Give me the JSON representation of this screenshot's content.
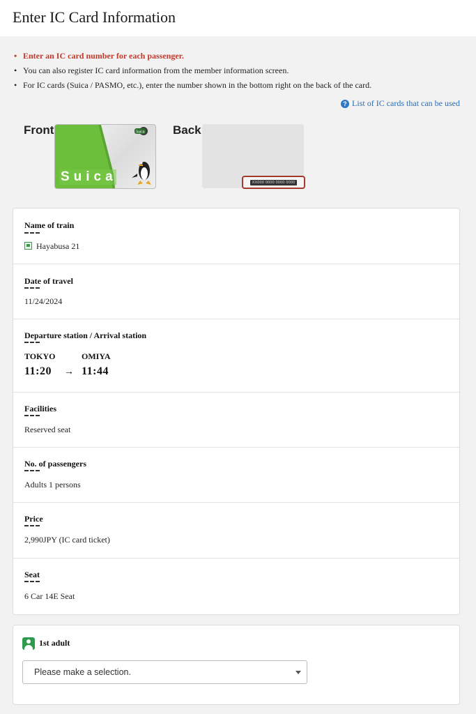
{
  "page": {
    "title": "Enter IC Card Information"
  },
  "notes": [
    "Enter an IC card number for each passenger.",
    "You can also register IC card information from the member information screen.",
    "For IC cards (Suica / PASMO, etc.), enter the number shown in the bottom right on the back of the card."
  ],
  "ic_link": {
    "label": "List of IC cards that can be used",
    "icon": "help-icon"
  },
  "card": {
    "front_label": "Front",
    "back_label": "Back",
    "brand": "Suica",
    "number_placeholder": "XX000 0000 0000 0000"
  },
  "trip": {
    "train": {
      "label": "Name of train",
      "value": "Hayabusa 21",
      "icon": "train-icon"
    },
    "date": {
      "label": "Date of travel",
      "value": "11/24/2024"
    },
    "stations": {
      "label": "Departure station / Arrival station",
      "departure": "TOKYO",
      "arrival": "OMIYA",
      "departure_time": "11:20",
      "arrow": "→",
      "arrival_time": "11:44"
    },
    "facilities": {
      "label": "Facilities",
      "value": "Reserved seat"
    },
    "passengers": {
      "label": "No. of passengers",
      "value": "Adults 1 persons"
    },
    "price": {
      "label": "Price",
      "value": "2,990JPY (IC card ticket)"
    },
    "seat": {
      "label": "Seat",
      "value": "6 Car 14E Seat"
    }
  },
  "passenger_form": {
    "label": "1st adult",
    "icon": "person-icon",
    "select_value": "Please make a selection."
  },
  "colors": {
    "notice_red": "#c0392b",
    "link_blue": "#2b6cb0",
    "accent_green": "#2e9a4e",
    "highlight_border": "#a63a2a"
  }
}
